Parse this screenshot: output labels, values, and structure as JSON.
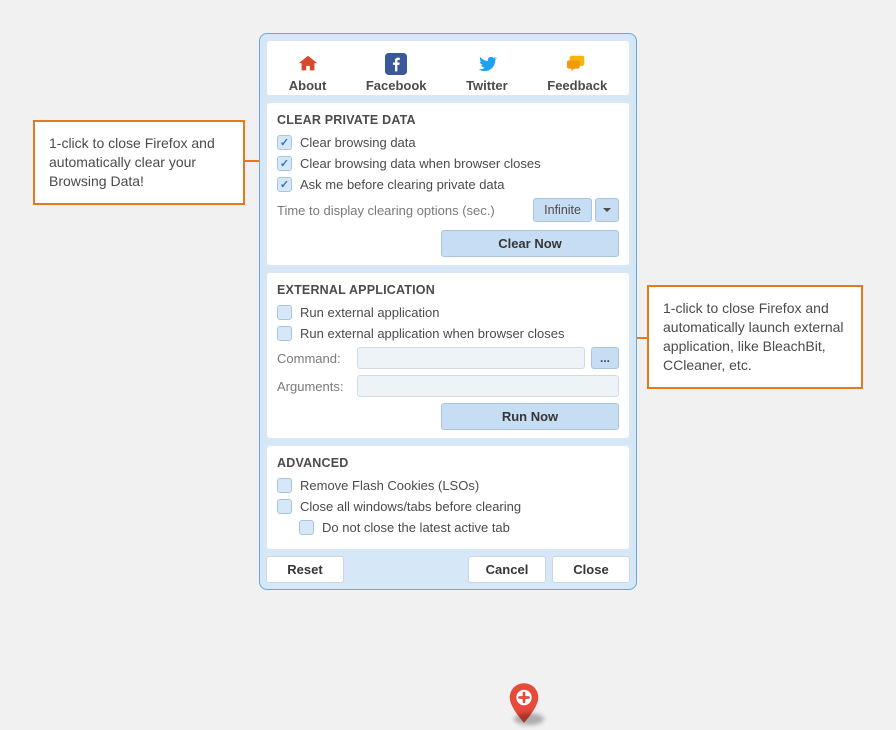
{
  "tabs": {
    "about": "About",
    "facebook": "Facebook",
    "twitter": "Twitter",
    "feedback": "Feedback"
  },
  "clear": {
    "title": "CLEAR PRIVATE DATA",
    "opt1": "Clear browsing data",
    "opt2": "Clear browsing data when browser closes",
    "opt3": "Ask me before clearing private data",
    "time_label": "Time to display clearing options (sec.)",
    "time_value": "Infinite",
    "clear_now": "Clear Now"
  },
  "ext": {
    "title": "EXTERNAL APPLICATION",
    "opt1": "Run external application",
    "opt2": "Run external application when browser closes",
    "cmd_label": "Command:",
    "arg_label": "Arguments:",
    "browse": "...",
    "run_now": "Run Now"
  },
  "adv": {
    "title": "ADVANCED",
    "opt1": "Remove Flash Cookies (LSOs)",
    "opt2": "Close all windows/tabs before clearing",
    "opt2a": "Do not close the latest active tab"
  },
  "footer": {
    "reset": "Reset",
    "cancel": "Cancel",
    "close": "Close"
  },
  "callout_left": "1-click to close Firefox and automatically clear your Browsing Data!",
  "callout_right": "1-click to close Firefox and automatically launch external application, like BleachBit, CCleaner, etc."
}
